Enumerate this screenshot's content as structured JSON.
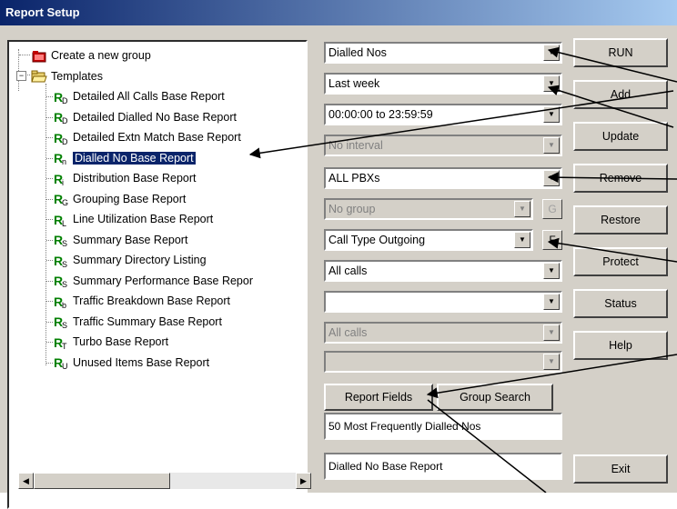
{
  "window": {
    "title": "Report Setup"
  },
  "tree": {
    "items": [
      {
        "label": "Create a new group",
        "icon": "folder-icon"
      },
      {
        "label": "Templates",
        "icon": "folder-open-icon"
      },
      {
        "label": "Detailed All Calls Base Report",
        "icon": "report-icon",
        "badge": "D"
      },
      {
        "label": "Detailed Dialled No Base Report",
        "icon": "report-icon",
        "badge": "D"
      },
      {
        "label": "Detailed Extn Match Base Report",
        "icon": "report-icon",
        "badge": "D"
      },
      {
        "label": "Dialled No Base Report",
        "icon": "report-icon",
        "badge": "n",
        "selected": true
      },
      {
        "label": "Distribution Base Report",
        "icon": "report-icon",
        "badge": "i"
      },
      {
        "label": "Grouping Base Report",
        "icon": "report-icon",
        "badge": "G"
      },
      {
        "label": "Line Utilization Base Report",
        "icon": "report-icon",
        "badge": "L"
      },
      {
        "label": "Summary Base Report",
        "icon": "report-icon",
        "badge": "S"
      },
      {
        "label": "Summary Directory Listing",
        "icon": "report-icon",
        "badge": "S"
      },
      {
        "label": "Summary Performance Base Repor",
        "icon": "report-icon",
        "badge": "S"
      },
      {
        "label": "Traffic Breakdown Base Report",
        "icon": "report-icon",
        "badge": "b"
      },
      {
        "label": "Traffic Summary Base Report",
        "icon": "report-icon",
        "badge": "S"
      },
      {
        "label": "Turbo Base Report",
        "icon": "report-icon",
        "badge": "T"
      },
      {
        "label": "Unused Items Base Report",
        "icon": "report-icon",
        "badge": "U"
      }
    ]
  },
  "combos": {
    "report_type": "Dialled Nos",
    "period": "Last week",
    "time_range": "00:00:00 to 23:59:59",
    "interval": "No interval",
    "pbx": "ALL PBXs",
    "group": "No group",
    "call_type": "Call Type Outgoing",
    "calls": "All calls",
    "blank1": "",
    "calls2": "All calls",
    "blank2": ""
  },
  "small_buttons": {
    "group": "G",
    "filter": "F"
  },
  "report_fields_button": "Report Fields",
  "group_search_button": "Group Search",
  "description": "50 Most Frequently Dialled Nos",
  "report_name": "Dialled No Base Report",
  "buttons": {
    "run": "RUN",
    "add": "Add",
    "update": "Update",
    "remove": "Remove",
    "restore": "Restore",
    "protect": "Protect",
    "status": "Status",
    "help": "Help",
    "exit": "Exit"
  },
  "colors": {
    "title_bar": "#0a246a",
    "selection": "#0a246a",
    "face": "#d4d0c8",
    "report_icon": "#008000"
  }
}
